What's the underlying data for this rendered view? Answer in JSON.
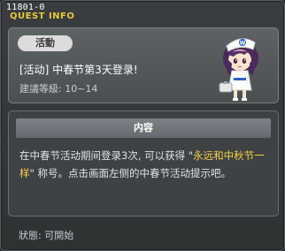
{
  "window": {
    "quest_id": "11801-0",
    "title": "QUEST INFO"
  },
  "quest": {
    "tag": "活動",
    "name": "[活动] 中春节第3天登录!",
    "level": "建議等級: 10~14"
  },
  "content": {
    "header": "内容",
    "text_before": "在中春节活动期间登录3次, 可以获得 \"",
    "highlight": "永远和中秋节一样",
    "text_after": "\" 称号。点击画面左侧的中春节活动提示吧。"
  },
  "status": {
    "label": "狀態: 可開始"
  },
  "colors": {
    "title": "#e8c83a",
    "highlight": "#f4d24a",
    "panel": "#4b4f52"
  },
  "icons": {
    "npc": "nurse-npc-portrait"
  }
}
